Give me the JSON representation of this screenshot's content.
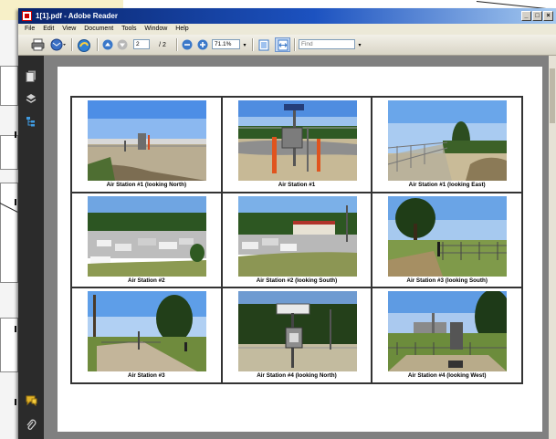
{
  "window": {
    "title": "1[1].pdf - Adobe Reader",
    "controls": [
      "_",
      "□",
      "×"
    ]
  },
  "menu": [
    "File",
    "Edit",
    "View",
    "Document",
    "Tools",
    "Window",
    "Help"
  ],
  "toolbar": {
    "current_page": "2",
    "total_pages": "/ 2",
    "zoom": "71.1%",
    "find_placeholder": "Find"
  },
  "document": {
    "captions": [
      "Air Station #1 (looking North)",
      "Air Station #1",
      "Air Station #1 (looking East)",
      "Air Station #2",
      "Air Station #2 (looking South)",
      "Air Station #3 (looking South)",
      "Air Station #3",
      "Air Station #4 (looking North)",
      "Air Station #4 (looking West)"
    ]
  },
  "icons": {
    "print": "printer-icon",
    "email": "email-icon",
    "prev": "arrow-up-icon",
    "next": "arrow-down-icon",
    "zoom_out": "minus-circle-icon",
    "zoom_in": "plus-circle-icon",
    "pages": "pages-icon",
    "layers": "layers-icon",
    "tree": "tree-icon",
    "comments": "comments-icon",
    "attach": "paperclip-icon"
  }
}
